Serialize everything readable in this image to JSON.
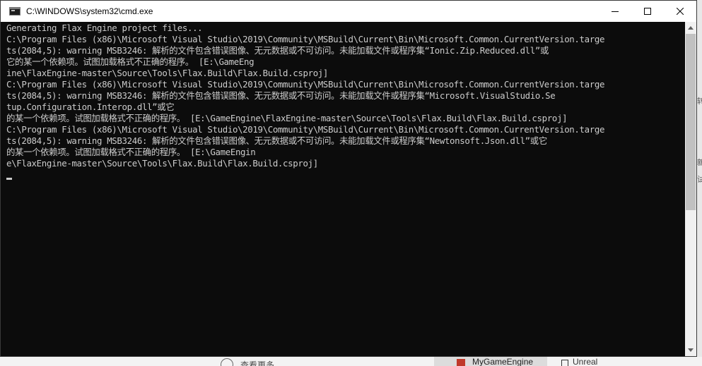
{
  "window": {
    "title": "C:\\WINDOWS\\system32\\cmd.exe"
  },
  "console": {
    "lines": [
      "Generating Flax Engine project files...",
      "C:\\Program Files (x86)\\Microsoft Visual Studio\\2019\\Community\\MSBuild\\Current\\Bin\\Microsoft.Common.CurrentVersion.targe",
      "ts(2084,5): warning MSB3246: 解析的文件包含错误图像、无元数据或不可访问。未能加载文件或程序集“Ionic.Zip.Reduced.dll”或",
      "它的某一个依赖项。试图加载格式不正确的程序。 [E:\\GameEng",
      "ine\\FlaxEngine-master\\Source\\Tools\\Flax.Build\\Flax.Build.csproj]",
      "C:\\Program Files (x86)\\Microsoft Visual Studio\\2019\\Community\\MSBuild\\Current\\Bin\\Microsoft.Common.CurrentVersion.targe",
      "ts(2084,5): warning MSB3246: 解析的文件包含错误图像、无元数据或不可访问。未能加载文件或程序集“Microsoft.VisualStudio.Se",
      "tup.Configuration.Interop.dll”或它",
      "的某一个依赖项。试图加载格式不正确的程序。 [E:\\GameEngine\\FlaxEngine-master\\Source\\Tools\\Flax.Build\\Flax.Build.csproj]",
      "C:\\Program Files (x86)\\Microsoft Visual Studio\\2019\\Community\\MSBuild\\Current\\Bin\\Microsoft.Common.CurrentVersion.targe",
      "ts(2084,5): warning MSB3246: 解析的文件包含错误图像、无元数据或不可访问。未能加载文件或程序集“Newtonsoft.Json.dll”或它",
      "的某一个依赖项。试图加载格式不正确的程序。 [E:\\GameEngin",
      "e\\FlaxEngine-master\\Source\\Tools\\Flax.Build\\Flax.Build.csproj]"
    ]
  },
  "background": {
    "link_text": "查看更多",
    "task1_label": "MyGameEngine",
    "task2_label": "Unreal",
    "edge_chars": [
      "转",
      "新",
      "试"
    ]
  },
  "icons": {
    "window_icon": "cmd-icon",
    "minimize": "minimize-icon",
    "maximize": "maximize-icon",
    "close": "close-icon",
    "scroll_up": "scroll-up-icon",
    "scroll_down": "scroll-down-icon"
  }
}
